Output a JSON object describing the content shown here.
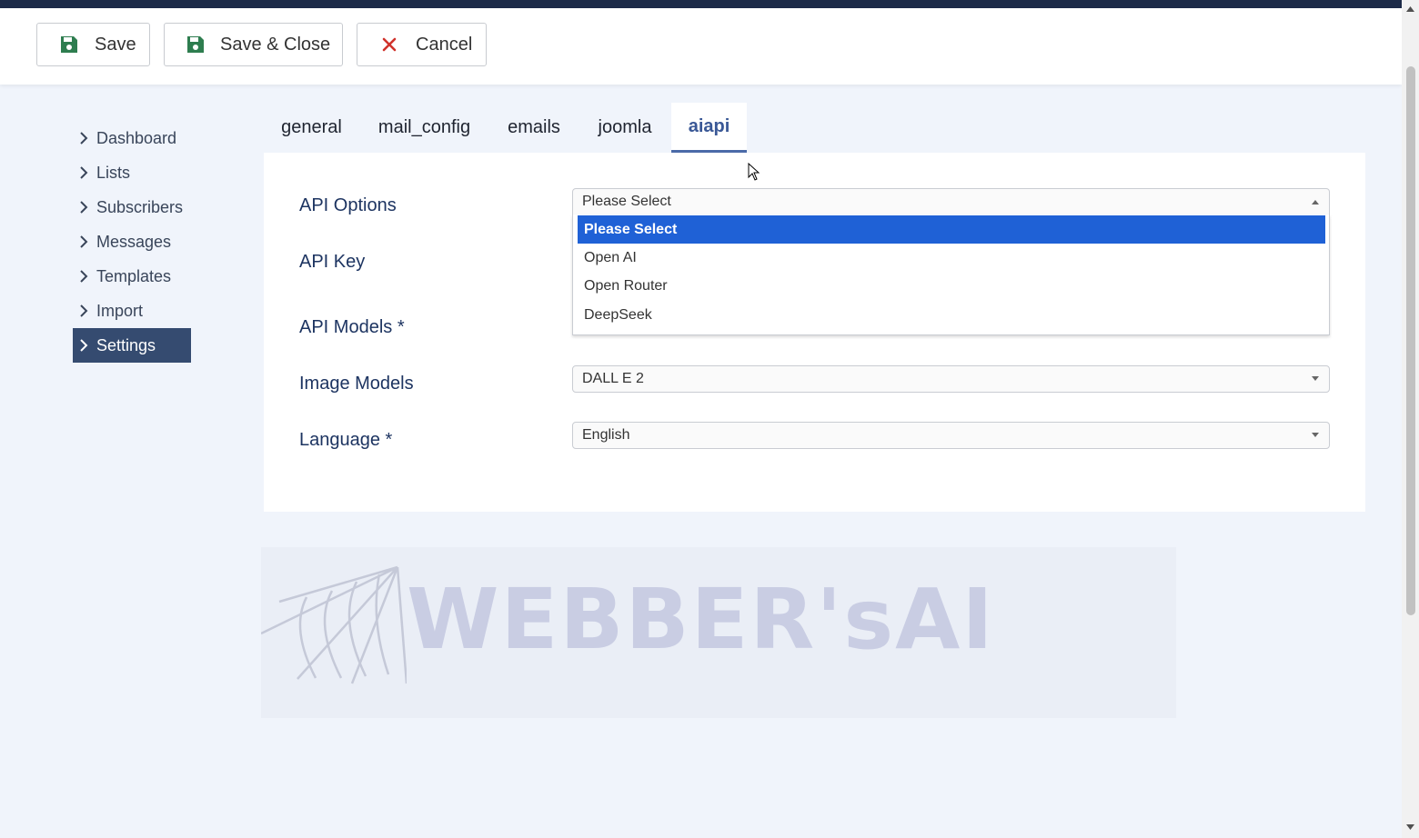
{
  "toolbar": {
    "save_label": "Save",
    "save_close_label": "Save & Close",
    "cancel_label": "Cancel"
  },
  "sidebar": {
    "items": [
      {
        "label": "Dashboard"
      },
      {
        "label": "Lists"
      },
      {
        "label": "Subscribers"
      },
      {
        "label": "Messages"
      },
      {
        "label": "Templates"
      },
      {
        "label": "Import"
      },
      {
        "label": "Settings",
        "active": true
      }
    ]
  },
  "tabs": [
    {
      "label": "general"
    },
    {
      "label": "mail_config"
    },
    {
      "label": "emails"
    },
    {
      "label": "joomla"
    },
    {
      "label": "aiapi",
      "active": true
    }
  ],
  "form": {
    "api_options": {
      "label": "API Options",
      "value": "Please Select",
      "options": [
        "Please Select",
        "Open AI",
        "Open Router",
        "DeepSeek"
      ]
    },
    "api_key": {
      "label": "API Key"
    },
    "api_models": {
      "label": "API Models *"
    },
    "image_models": {
      "label": "Image Models",
      "value": "DALL E 2"
    },
    "language": {
      "label": "Language *",
      "value": "English"
    }
  },
  "logo": {
    "text": "WEBBER'sAI"
  },
  "colors": {
    "topbar": "#1c2a48",
    "sidebar_active": "#354b70",
    "tab_active": "#3a5896",
    "option_selected": "#1f61d6",
    "label": "#1d3461",
    "save_icon": "#2e7d4f",
    "cancel_icon": "#d0322b"
  }
}
